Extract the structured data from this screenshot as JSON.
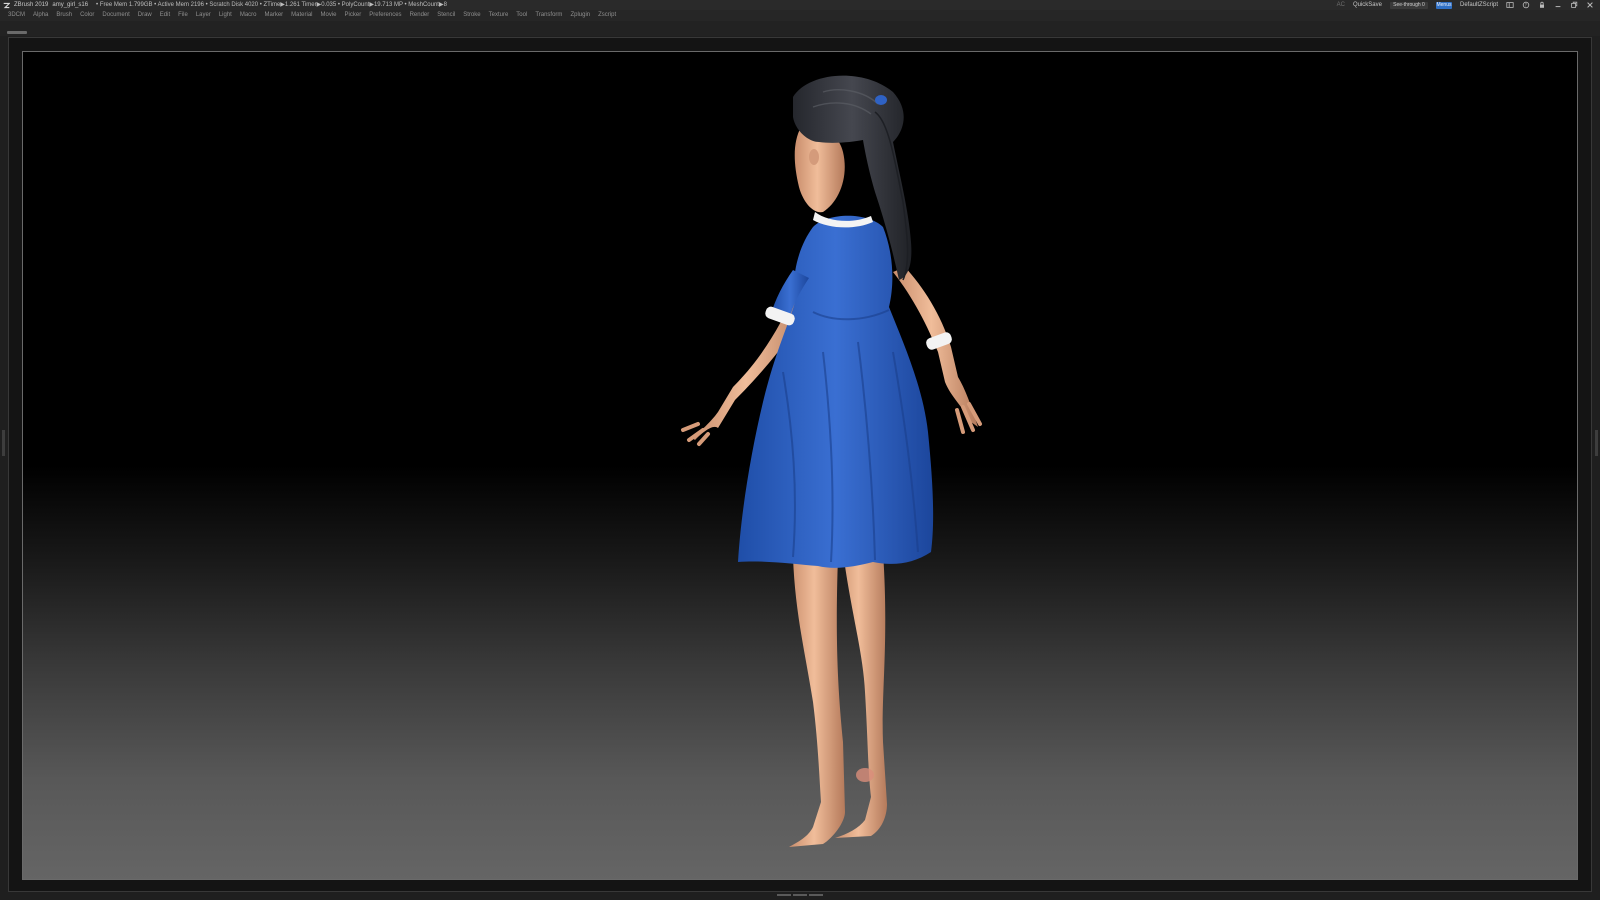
{
  "title_bar": {
    "app": "ZBrush 2019",
    "file": "amy_girl_s16",
    "stats": "• Free Mem 1.799GB • Active Mem 2196 • Scratch Disk 4020 • ZTime▶1.261 Timer▶0.035 • PolyCount▶19.713 MP • MeshCount▶8",
    "ac": "AC",
    "quicksave": "QuickSave",
    "see_through": "See-through 0",
    "see_through_level": 0,
    "menus": "Menus",
    "script": "DefaultZScript"
  },
  "menu_bar": {
    "items": [
      "3DCM",
      "Alpha",
      "Brush",
      "Color",
      "Document",
      "Draw",
      "Edit",
      "File",
      "Layer",
      "Light",
      "Macro",
      "Marker",
      "Material",
      "Movie",
      "Picker",
      "Preferences",
      "Render",
      "Stencil",
      "Stroke",
      "Texture",
      "Tool",
      "Transform",
      "Zplugin",
      "Zscript"
    ]
  },
  "icons": {
    "logo": "zbrush-logo-icon",
    "layout": "layout-icon",
    "help": "help-icon",
    "lock": "lock-icon",
    "minimize": "minimize-icon",
    "restore": "restore-icon",
    "close": "close-icon"
  },
  "colors": {
    "dress": "#2f62c4",
    "skin": "#e7b08d",
    "hair": "#33353d",
    "menus_button": "#2f6fc4"
  }
}
